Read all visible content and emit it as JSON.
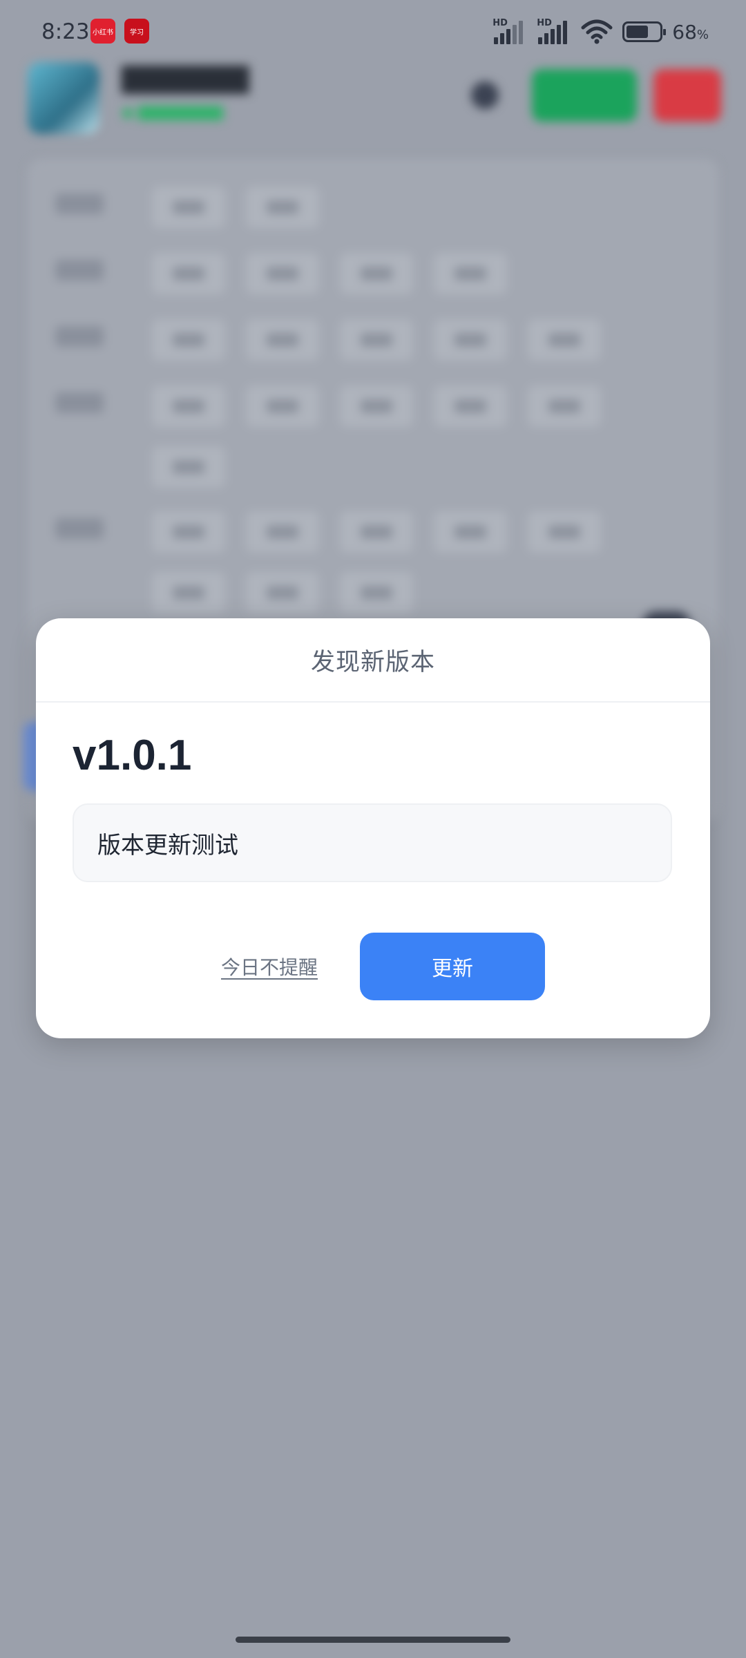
{
  "status_bar": {
    "time": "8:23",
    "app_icon_1": "小红书",
    "app_icon_2": "学习",
    "signal_1_label": "HD",
    "signal_2_label": "HD",
    "battery_percent": "68",
    "battery_unit": "%",
    "battery_level": 0.68
  },
  "dialog": {
    "title": "发现新版本",
    "version": "v1.0.1",
    "release_notes": "版本更新测试",
    "skip_label": "今日不提醒",
    "update_label": "更新",
    "accent_color": "#3b82f6"
  }
}
